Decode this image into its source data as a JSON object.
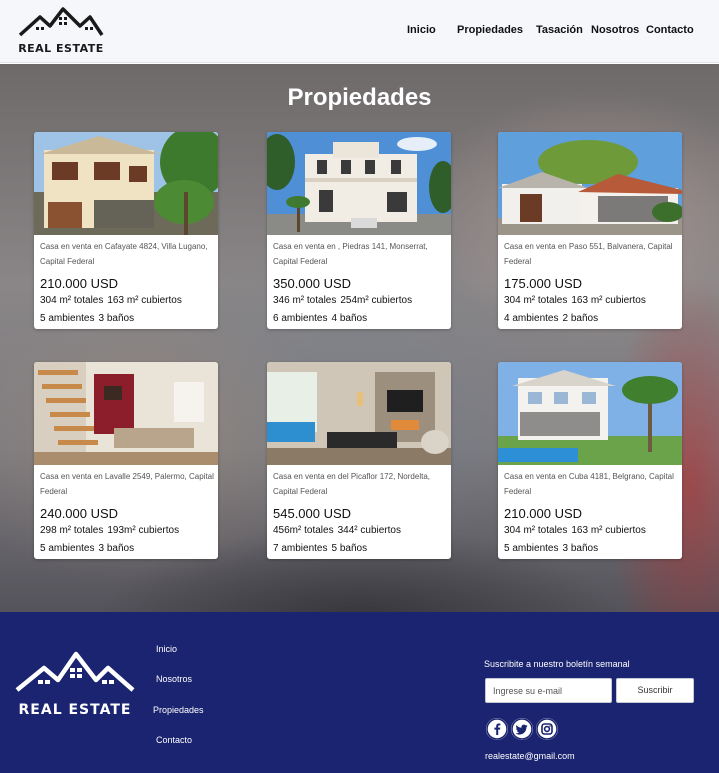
{
  "header": {
    "logo_text": "REAL ESTATE",
    "nav": [
      "Inicio",
      "Propiedades",
      "Tasación",
      "Nosotros",
      "Contacto"
    ]
  },
  "main": {
    "title": "Propiedades",
    "listings": [
      {
        "address": "Casa en venta en Cafayate 4824, Villa Lugano, Capital Federal",
        "price": "210.000 USD",
        "total_area": "304 m² totales",
        "covered_area": "163 m² cubiertos",
        "rooms": "5 ambientes",
        "baths": "3 baños"
      },
      {
        "address": "Casa en venta en , Piedras 141, Monserrat, Capital Federal",
        "price": "350.000 USD",
        "total_area": "346 m² totales",
        "covered_area": "254m² cubiertos",
        "rooms": "6 ambientes",
        "baths": "4 baños"
      },
      {
        "address": "Casa en venta en Paso 551, Balvanera, Capital Federal",
        "price": "175.000 USD",
        "total_area": "304 m² totales",
        "covered_area": "163 m² cubiertos",
        "rooms": "4 ambientes",
        "baths": "2 baños"
      },
      {
        "address": "Casa en venta en Lavalle 2549, Palermo, Capital Federal",
        "price": "240.000 USD",
        "total_area": "298 m² totales",
        "covered_area": "193m² cubiertos",
        "rooms": "5 ambientes",
        "baths": "3 baños"
      },
      {
        "address": "Casa en venta en del Picaflor 172, Nordelta, Capital Federal",
        "price": "545.000 USD",
        "total_area": "456m² totales",
        "covered_area": "344² cubiertos",
        "rooms": "7 ambientes",
        "baths": "5 baños"
      },
      {
        "address": "Casa en venta en Cuba 4181, Belgrano, Capital Federal",
        "price": "210.000 USD",
        "total_area": "304 m² totales",
        "covered_area": "163 m² cubiertos",
        "rooms": "5 ambientes",
        "baths": "3 baños"
      }
    ]
  },
  "footer": {
    "logo_text": "REAL ESTATE",
    "links": [
      "Inicio",
      "Nosotros",
      "Propiedades",
      "Contacto"
    ],
    "newsletter_title": "Suscribite a nuestro boletín semanal",
    "email_placeholder": "Ingrese su e-mail",
    "subscribe_label": "Suscribir",
    "social": [
      "facebook-icon",
      "twitter-icon",
      "instagram-icon"
    ],
    "contact_email": "realestate@gmail.com"
  },
  "colors": {
    "footer_bg": "#1b2470",
    "header_bg": "#f5f7fb",
    "card_bg": "#ffffff"
  }
}
